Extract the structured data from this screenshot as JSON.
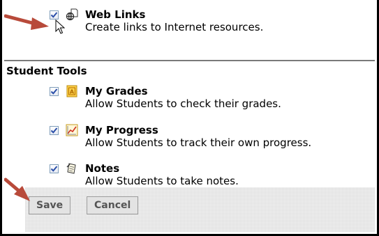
{
  "top_tool": {
    "name": "Web Links",
    "description": "Create links to Internet resources.",
    "checked": true,
    "icon": "globe-link-icon"
  },
  "student_tools": {
    "title": "Student Tools",
    "items": [
      {
        "name": "My Grades",
        "description": "Allow Students to check their grades.",
        "checked": true,
        "icon": "grades-icon"
      },
      {
        "name": "My Progress",
        "description": "Allow Students to track their own progress.",
        "checked": true,
        "icon": "progress-chart-icon"
      },
      {
        "name": "Notes",
        "description": "Allow Students to take notes.",
        "checked": true,
        "icon": "notes-icon"
      }
    ]
  },
  "footer": {
    "save_label": "Save",
    "cancel_label": "Cancel"
  },
  "colors": {
    "annotation_arrow": "#b84a3a",
    "checkmark": "#2a4ea8",
    "grades_icon_bg": "#ffd34a"
  }
}
